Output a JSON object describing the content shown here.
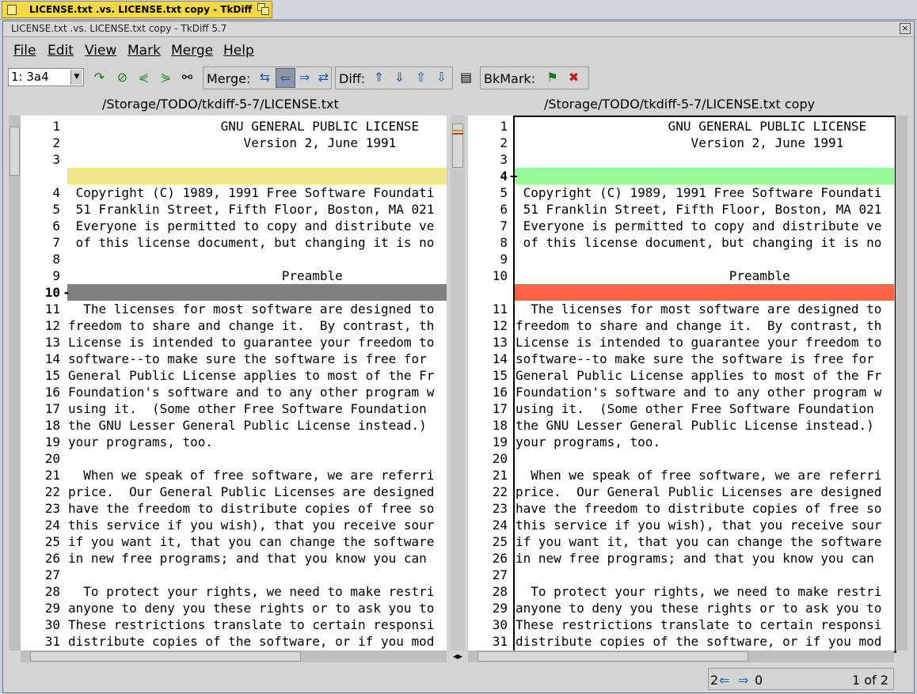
{
  "taskbar": {
    "label": "LICENSE.txt .vs. LICENSE.txt copy - TkDiff 5.7"
  },
  "window": {
    "title": "LICENSE.txt .vs. LICENSE.txt copy - TkDiff 5.7",
    "close": "×"
  },
  "menu": {
    "file": "File",
    "edit": "Edit",
    "view": "View",
    "mark": "Mark",
    "merge": "Merge",
    "help": "Help"
  },
  "toolbar": {
    "position": "1: 3a4",
    "merge_label": "Merge:",
    "diff_label": "Diff:",
    "bkmark_label": "BkMark:"
  },
  "left": {
    "path": "/Storage/TODO/tkdiff-5-7/LICENSE.txt",
    "lines": [
      {
        "n": "1",
        "m": "",
        "t": "                    GNU GENERAL PUBLIC LICENSE"
      },
      {
        "n": "2",
        "m": "",
        "t": "                       Version 2, June 1991"
      },
      {
        "n": "3",
        "m": "",
        "t": ""
      },
      {
        "n": "",
        "m": "",
        "t": "",
        "hl": "#f0e68c"
      },
      {
        "n": "4",
        "m": "",
        "t": " Copyright (C) 1989, 1991 Free Software Foundati"
      },
      {
        "n": "5",
        "m": "",
        "t": " 51 Franklin Street, Fifth Floor, Boston, MA 021"
      },
      {
        "n": "6",
        "m": "",
        "t": " Everyone is permitted to copy and distribute ve"
      },
      {
        "n": "7",
        "m": "",
        "t": " of this license document, but changing it is no"
      },
      {
        "n": "8",
        "m": "",
        "t": ""
      },
      {
        "n": "9",
        "m": "",
        "t": "                            Preamble"
      },
      {
        "n": "10",
        "m": "-",
        "t": "",
        "hl": "#808080",
        "bold": true
      },
      {
        "n": "11",
        "m": "",
        "t": "  The licenses for most software are designed to"
      },
      {
        "n": "12",
        "m": "",
        "t": "freedom to share and change it.  By contrast, th"
      },
      {
        "n": "13",
        "m": "",
        "t": "License is intended to guarantee your freedom to"
      },
      {
        "n": "14",
        "m": "",
        "t": "software--to make sure the software is free for"
      },
      {
        "n": "15",
        "m": "",
        "t": "General Public License applies to most of the Fr"
      },
      {
        "n": "16",
        "m": "",
        "t": "Foundation's software and to any other program w"
      },
      {
        "n": "17",
        "m": "",
        "t": "using it.  (Some other Free Software Foundation"
      },
      {
        "n": "18",
        "m": "",
        "t": "the GNU Lesser General Public License instead.)"
      },
      {
        "n": "19",
        "m": "",
        "t": "your programs, too."
      },
      {
        "n": "20",
        "m": "",
        "t": ""
      },
      {
        "n": "21",
        "m": "",
        "t": "  When we speak of free software, we are referri"
      },
      {
        "n": "22",
        "m": "",
        "t": "price.  Our General Public Licenses are designed"
      },
      {
        "n": "23",
        "m": "",
        "t": "have the freedom to distribute copies of free so"
      },
      {
        "n": "24",
        "m": "",
        "t": "this service if you wish), that you receive sour"
      },
      {
        "n": "25",
        "m": "",
        "t": "if you want it, that you can change the software"
      },
      {
        "n": "26",
        "m": "",
        "t": "in new free programs; and that you know you can"
      },
      {
        "n": "27",
        "m": "",
        "t": ""
      },
      {
        "n": "28",
        "m": "",
        "t": "  To protect your rights, we need to make restri"
      },
      {
        "n": "29",
        "m": "",
        "t": "anyone to deny you these rights or to ask you to"
      },
      {
        "n": "30",
        "m": "",
        "t": "These restrictions translate to certain responsi"
      },
      {
        "n": "31",
        "m": "",
        "t": "distribute copies of the software, or if you mod"
      }
    ]
  },
  "right": {
    "path": "/Storage/TODO/tkdiff-5-7/LICENSE.txt copy",
    "lines": [
      {
        "n": "1",
        "m": "",
        "t": "                    GNU GENERAL PUBLIC LICENSE"
      },
      {
        "n": "2",
        "m": "",
        "t": "                       Version 2, June 1991"
      },
      {
        "n": "3",
        "m": "",
        "t": ""
      },
      {
        "n": "4",
        "m": "+",
        "t": "",
        "hl": "#98fb98",
        "bold": true
      },
      {
        "n": "5",
        "m": "",
        "t": " Copyright (C) 1989, 1991 Free Software Foundati"
      },
      {
        "n": "6",
        "m": "",
        "t": " 51 Franklin Street, Fifth Floor, Boston, MA 021"
      },
      {
        "n": "7",
        "m": "",
        "t": " Everyone is permitted to copy and distribute ve"
      },
      {
        "n": "8",
        "m": "",
        "t": " of this license document, but changing it is no"
      },
      {
        "n": "9",
        "m": "",
        "t": ""
      },
      {
        "n": "10",
        "m": "",
        "t": "                            Preamble"
      },
      {
        "n": "",
        "m": "",
        "t": "",
        "hl": "#ff6347"
      },
      {
        "n": "11",
        "m": "",
        "t": "  The licenses for most software are designed to"
      },
      {
        "n": "12",
        "m": "",
        "t": "freedom to share and change it.  By contrast, th"
      },
      {
        "n": "13",
        "m": "",
        "t": "License is intended to guarantee your freedom to"
      },
      {
        "n": "14",
        "m": "",
        "t": "software--to make sure the software is free for"
      },
      {
        "n": "15",
        "m": "",
        "t": "General Public License applies to most of the Fr"
      },
      {
        "n": "16",
        "m": "",
        "t": "Foundation's software and to any other program w"
      },
      {
        "n": "17",
        "m": "",
        "t": "using it.  (Some other Free Software Foundation"
      },
      {
        "n": "18",
        "m": "",
        "t": "the GNU Lesser General Public License instead.)"
      },
      {
        "n": "19",
        "m": "",
        "t": "your programs, too."
      },
      {
        "n": "20",
        "m": "",
        "t": ""
      },
      {
        "n": "21",
        "m": "",
        "t": "  When we speak of free software, we are referri"
      },
      {
        "n": "22",
        "m": "",
        "t": "price.  Our General Public Licenses are designed"
      },
      {
        "n": "23",
        "m": "",
        "t": "have the freedom to distribute copies of free so"
      },
      {
        "n": "24",
        "m": "",
        "t": "this service if you wish), that you receive sour"
      },
      {
        "n": "25",
        "m": "",
        "t": "if you want it, that you can change the software"
      },
      {
        "n": "26",
        "m": "",
        "t": "in new free programs; and that you know you can"
      },
      {
        "n": "27",
        "m": "",
        "t": ""
      },
      {
        "n": "28",
        "m": "",
        "t": "  To protect your rights, we need to make restri"
      },
      {
        "n": "29",
        "m": "",
        "t": "anyone to deny you these rights or to ask you to"
      },
      {
        "n": "30",
        "m": "",
        "t": "These restrictions translate to certain responsi"
      },
      {
        "n": "31",
        "m": "",
        "t": "distribute copies of the software, or if you mod"
      }
    ]
  },
  "status": {
    "left_count": "2",
    "right_count": "0",
    "position": "1 of 2"
  }
}
